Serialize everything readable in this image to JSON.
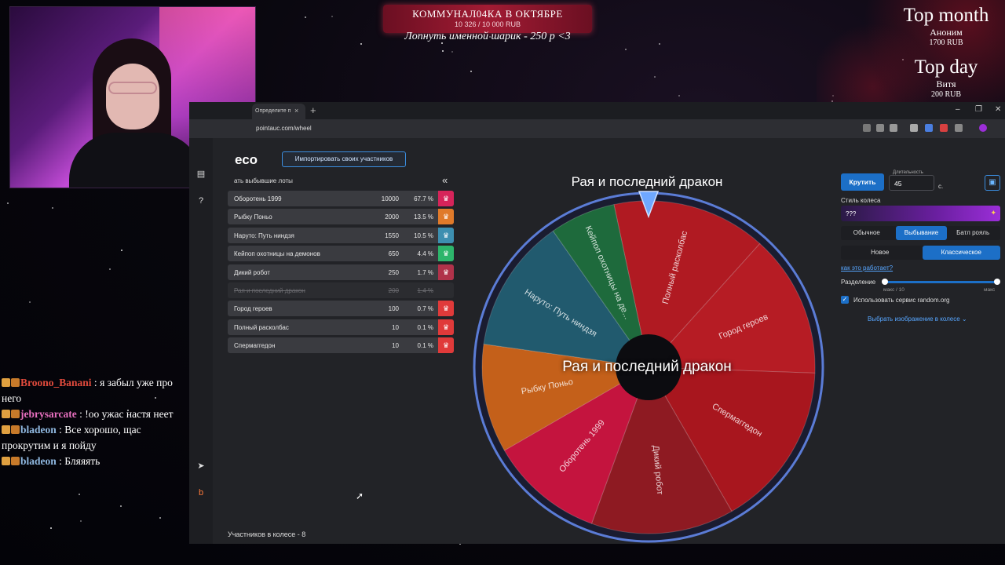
{
  "overlay": {
    "goal_title": "КОММУНАЛ04КА В ОКТЯБРЕ",
    "goal_amount": "10 326 / 10 000 RUB",
    "goal_sub": "Лопнуть именной шарик - 250 р <3",
    "top_month": {
      "title": "Top month",
      "name": "Аноним",
      "amount": "1700 RUB"
    },
    "top_day": {
      "title": "Top day",
      "name": "Витя",
      "amount": "200 RUB"
    }
  },
  "chat": [
    {
      "user": "Broono_Banani",
      "color": "#e04a3c",
      "text": "я забыл уже про него"
    },
    {
      "user": "jebrysarcate",
      "color": "#e86fbf",
      "text": "!оо ужас настя неет"
    },
    {
      "user": "bladeon",
      "color": "#8fb8e0",
      "text": "Все хорошо, щас прокрутим и я пойду"
    },
    {
      "user": "bladeon",
      "color": "#8fb8e0",
      "text": "Бляяять"
    }
  ],
  "browser": {
    "tab_title": "Определите п",
    "url": "pointauc.com/wheel",
    "new_tab": "+",
    "close": "×",
    "win_min": "–",
    "win_max": "❐",
    "win_close": "✕"
  },
  "page": {
    "title": "есо",
    "import_button": "Импортировать своих участников",
    "lots_header": "ать выбывшие лоты",
    "collapse": "«",
    "participants": "Участников в колесе - 8"
  },
  "lots": [
    {
      "name": "Оборотень 1999",
      "amount": "10000",
      "pct": "67.7 %",
      "color": "#d6245a",
      "out": false
    },
    {
      "name": "Рыбку Поньо",
      "amount": "2000",
      "pct": "13.5 %",
      "color": "#e07a2a",
      "out": false
    },
    {
      "name": "Наруто: Путь ниндзя",
      "amount": "1550",
      "pct": "10.5 %",
      "color": "#3d8fb0",
      "out": false
    },
    {
      "name": "Кейпоп охотницы на демонов",
      "amount": "650",
      "pct": "4.4 %",
      "color": "#2db56b",
      "out": false
    },
    {
      "name": "Дикий робот",
      "amount": "250",
      "pct": "1.7 %",
      "color": "#b0324a",
      "out": false
    },
    {
      "name": "Рая и последний дракон",
      "amount": "200",
      "pct": "1.4 %",
      "color": "#2b2c30",
      "out": true
    },
    {
      "name": "Город героев",
      "amount": "100",
      "pct": "0.7 %",
      "color": "#e03a3a",
      "out": false
    },
    {
      "name": "Полный расколбас",
      "amount": "10",
      "pct": "0.1 %",
      "color": "#e03a3a",
      "out": false
    },
    {
      "name": "Спермаггедон",
      "amount": "10",
      "pct": "0.1 %",
      "color": "#e03a3a",
      "out": false
    }
  ],
  "wheel": {
    "title": "Рая и последний дракон",
    "center_text": "Рая и последний дракон",
    "segments": [
      {
        "label": "Полный расколбас",
        "color": "#b01a22"
      },
      {
        "label": "Город героев",
        "color": "#b61c24"
      },
      {
        "label": "Спермаггедон",
        "color": "#a8161e"
      },
      {
        "label": "Дикий робот",
        "color": "#8e1a22"
      },
      {
        "label": "Оборотень 1999",
        "color": "#c4143e"
      },
      {
        "label": "Рыбку Поньо",
        "color": "#c4601a"
      },
      {
        "label": "Наруто: Путь ниндзя",
        "color": "#215a6e"
      },
      {
        "label": "Кейпоп охотницы на де...",
        "color": "#1e6a3c"
      }
    ]
  },
  "controls": {
    "spin": "Крутить",
    "duration_label": "Длительность",
    "duration_value": "45",
    "duration_unit": "с.",
    "style_label": "Стиль колеса",
    "style_value": "???",
    "mode_tabs": [
      "Обычное",
      "Выбывание",
      "Батл рояль"
    ],
    "mode_active": 1,
    "variant_tabs": [
      "Новое",
      "Классическое"
    ],
    "variant_active": 1,
    "how_link": "как это работает?",
    "split_label": "Разделение",
    "split_min": "макс / 10",
    "split_max": "макс",
    "split_value": 1.0,
    "random_org_label": "Использовать сервис random.org",
    "random_org_checked": true,
    "choose_image": "Выбрать изображение в колесе"
  }
}
